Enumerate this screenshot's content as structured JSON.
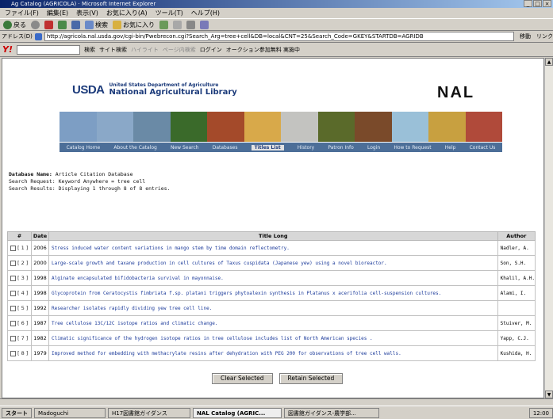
{
  "window": {
    "title": "Ag Catalog (AGRICOLA) · Microsoft Internet Explorer",
    "buttons": [
      "_",
      "□",
      "×"
    ]
  },
  "menubar": [
    "ファイル(F)",
    "編集(E)",
    "表示(V)",
    "お気に入り(A)",
    "ツール(T)",
    "ヘルプ(H)"
  ],
  "toolbar": {
    "back": "戻る",
    "search": "検索",
    "favorites": "お気に入り"
  },
  "addressbar": {
    "label": "アドレス(D)",
    "url": "http://agricola.nal.usda.gov/cgi-bin/Pwebrecon.cgi?Search_Arg=tree+cell&DB=local&CNT=25&Search_Code=GKEY&STARTDB=AGRIDB",
    "go": "移動",
    "links": "リンク"
  },
  "yahoobar": {
    "logo": "Y!",
    "search_btn": "検索",
    "site_search": "サイト検索",
    "highlight": "ハイライト",
    "page_search": "ページ内検索",
    "login": "ログイン",
    "auction": "オークション参加無料 実施中"
  },
  "header": {
    "logo": "USDA",
    "dept": "United States Department of Agriculture",
    "library": "National Agricultural Library",
    "nal": "NAL"
  },
  "banner_colors": [
    "#7d9ec4",
    "#8aa8c8",
    "#6a8aa6",
    "#3a6a2a",
    "#a44a2a",
    "#d8a94a",
    "#c3c3c0",
    "#5a6a2a",
    "#7a4a2a",
    "#9ac0d8",
    "#c8a040",
    "#b04a3a"
  ],
  "nav": {
    "items": [
      "Catalog Home",
      "About the Catalog",
      "New Search",
      "Databases",
      "Titles List",
      "History",
      "Patron Info",
      "Login",
      "How to Request",
      "Help",
      "Contact Us"
    ],
    "active_index": 4
  },
  "dbinfo": {
    "db_label": "Database Name:",
    "db_value": "Article Citation Database",
    "req_label": "Search Request:",
    "req_value": "Keyword Anywhere = tree cell",
    "res_label": "Search Results:",
    "res_value": "Displaying 1 through 8 of 8 entries."
  },
  "results": {
    "columns": [
      "#",
      "Date",
      "Title Long",
      "Author"
    ],
    "rows": [
      {
        "num": "[ 1 ]",
        "date": "2006",
        "title": "Stress induced water content variations in mango stem by time domain reflectometry.",
        "author": "Nadler, A."
      },
      {
        "num": "[ 2 ]",
        "date": "2000",
        "title": "Large-scale growth and taxane production in cell cultures of Taxus cuspidata (Japanese yew) using a novel bioreactor.",
        "author": "Son, S.H."
      },
      {
        "num": "[ 3 ]",
        "date": "1998",
        "title": "Alginate encapsulated bifidobacteria survival in mayonnaise.",
        "author": "Khalil, A.H."
      },
      {
        "num": "[ 4 ]",
        "date": "1998",
        "title": "Glycoprotein from Ceratocystis fimbriata f.sp. platani triggers phytoalexin synthesis in Platanus x acerifolia cell-suspension cultures.",
        "author": "Alami, I."
      },
      {
        "num": "[ 5 ]",
        "date": "1992",
        "title": "Researcher isolates rapidly dividing yew tree cell line.",
        "author": ""
      },
      {
        "num": "[ 6 ]",
        "date": "1987",
        "title": "Tree cellulose 13C/12C isotope ratios and climatic change.",
        "author": "Stuiver, M."
      },
      {
        "num": "[ 7 ]",
        "date": "1982",
        "title": "Climatic significance of the hydrogen isotope ratios in tree cellulose includes list of North American species .",
        "author": "Yapp, C.J."
      },
      {
        "num": "[ 8 ]",
        "date": "1979",
        "title": "Improved method for embedding with methacrylate resins after dehydration with PEG 200 for observations of tree cell walls.",
        "author": "Kushida, H."
      }
    ]
  },
  "buttons": {
    "clear": "Clear Selected",
    "retain": "Retain Selected"
  },
  "taskbar": {
    "start": "スタート",
    "tasks": [
      "Madoguchi",
      "H17図書館ガイダンス",
      "NAL Catalog (AGRIC...",
      "図書館ガイダンス-農学部..."
    ],
    "active_task": 2,
    "clock": "12:00"
  }
}
